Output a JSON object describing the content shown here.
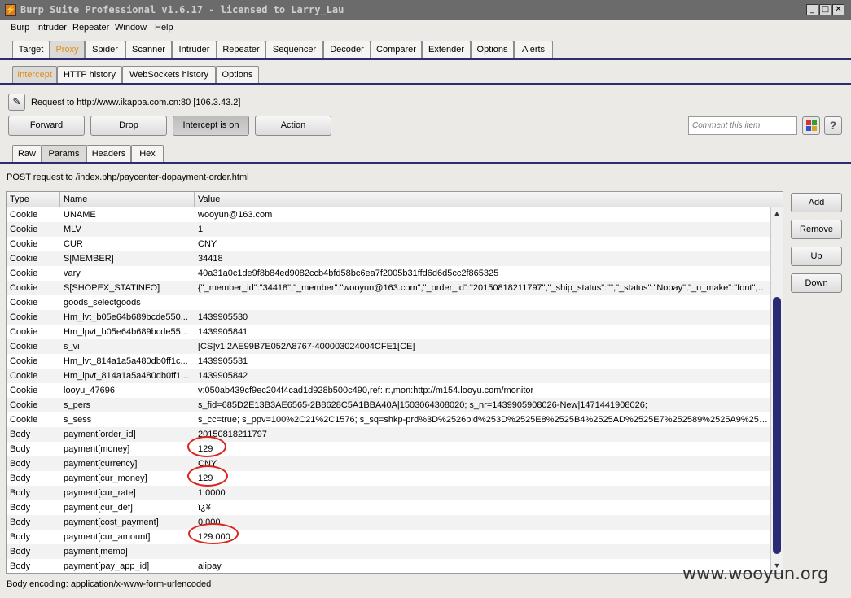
{
  "window": {
    "title": "Burp Suite Professional v1.6.17 - licensed to Larry_Lau",
    "minimize": "_",
    "maximize": "□",
    "close": "✕"
  },
  "menu": [
    "Burp",
    "Intruder",
    "Repeater",
    "Window",
    "Help"
  ],
  "main_tabs": [
    "Target",
    "Proxy",
    "Spider",
    "Scanner",
    "Intruder",
    "Repeater",
    "Sequencer",
    "Decoder",
    "Comparer",
    "Extender",
    "Options",
    "Alerts"
  ],
  "proxy_tabs": [
    "Intercept",
    "HTTP history",
    "WebSockets history",
    "Options"
  ],
  "request_info": "Request to http://www.ikappa.com.cn:80  [106.3.43.2]",
  "buttons": {
    "forward": "Forward",
    "drop": "Drop",
    "intercept": "Intercept is on",
    "action": "Action"
  },
  "comment_placeholder": "Comment this item",
  "help_icon": "?",
  "view_tabs": [
    "Raw",
    "Params",
    "Headers",
    "Hex"
  ],
  "post_line": "POST request to /index.php/paycenter-dopayment-order.html",
  "columns": [
    "Type",
    "Name",
    "Value"
  ],
  "params": [
    {
      "type": "Cookie",
      "name": "UNAME",
      "value": "wooyun@163.com"
    },
    {
      "type": "Cookie",
      "name": "MLV",
      "value": "1"
    },
    {
      "type": "Cookie",
      "name": "CUR",
      "value": "CNY"
    },
    {
      "type": "Cookie",
      "name": "S[MEMBER]",
      "value": "34418"
    },
    {
      "type": "Cookie",
      "name": "vary",
      "value": "40a31a0c1de9f8b84ed9082ccb4bfd58bc6ea7f2005b31ffd6d6d5cc2f865325"
    },
    {
      "type": "Cookie",
      "name": "S[SHOPEX_STATINFO]",
      "value": "{\"_member_id\":\"34418\",\"_member\":\"wooyun@163.com\",\"_order_id\":\"20150818211797\",\"_ship_status\":\"\",\"_status\":\"Nopay\",\"_u_make\":\"font\",\"..."
    },
    {
      "type": "Cookie",
      "name": "goods_selectgoods",
      "value": ""
    },
    {
      "type": "Cookie",
      "name": "Hm_lvt_b05e64b689bcde550...",
      "value": "1439905530"
    },
    {
      "type": "Cookie",
      "name": "Hm_lpvt_b05e64b689bcde55...",
      "value": "1439905841"
    },
    {
      "type": "Cookie",
      "name": "s_vi",
      "value": "[CS]v1|2AE99B7E052A8767-400003024004CFE1[CE]"
    },
    {
      "type": "Cookie",
      "name": "Hm_lvt_814a1a5a480db0ff1c...",
      "value": "1439905531"
    },
    {
      "type": "Cookie",
      "name": "Hm_lpvt_814a1a5a480db0ff1...",
      "value": "1439905842"
    },
    {
      "type": "Cookie",
      "name": "looyu_47696",
      "value": "v:050ab439cf9ec204f4cad1d928b500c490,ref:,r:,mon:http://m154.looyu.com/monitor"
    },
    {
      "type": "Cookie",
      "name": "s_pers",
      "value": " s_fid=685D2E13B3AE6565-2B8628C5A1BBA40A|1503064308020; s_nr=1439905908026-New|1471441908026;"
    },
    {
      "type": "Cookie",
      "name": "s_sess",
      "value": " s_cc=true; s_ppv=100%2C21%2C1576; s_sq=shkp-prd%3D%2526pid%253D%2525E8%2525B4%2525AD%2525E7%252589%2525A9%252..."
    },
    {
      "type": "Body",
      "name": "payment[order_id]",
      "value": "20150818211797"
    },
    {
      "type": "Body",
      "name": "payment[money]",
      "value": "129"
    },
    {
      "type": "Body",
      "name": "payment[currency]",
      "value": "CNY"
    },
    {
      "type": "Body",
      "name": "payment[cur_money]",
      "value": "129"
    },
    {
      "type": "Body",
      "name": "payment[cur_rate]",
      "value": "1.0000"
    },
    {
      "type": "Body",
      "name": "payment[cur_def]",
      "value": "ï¿¥"
    },
    {
      "type": "Body",
      "name": "payment[cost_payment]",
      "value": "0.000"
    },
    {
      "type": "Body",
      "name": "payment[cur_amount]",
      "value": "129.000"
    },
    {
      "type": "Body",
      "name": "payment[memo]",
      "value": ""
    },
    {
      "type": "Body",
      "name": "payment[pay_app_id]",
      "value": "alipay"
    }
  ],
  "side_buttons": [
    "Add",
    "Remove",
    "Up",
    "Down"
  ],
  "body_encoding": "Body encoding:  application/x-www-form-urlencoded",
  "watermark": "www.wooyun.org",
  "colors": {
    "active_tab_text": "#e08c1a",
    "separator": "#2c2c6e",
    "annotation": "#d8261f"
  }
}
